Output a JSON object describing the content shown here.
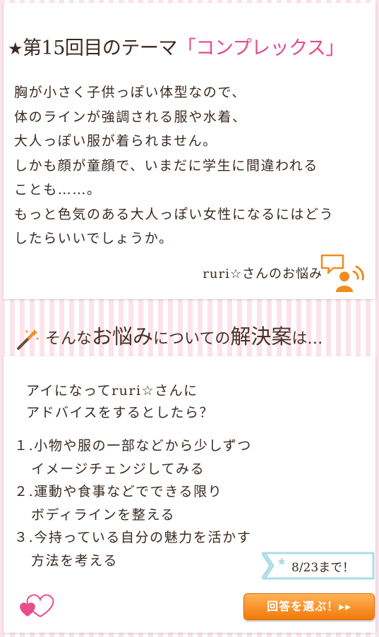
{
  "theme": {
    "star": "★",
    "title_prefix": "第15回目のテーマ",
    "title_highlight": "「コンプレックス」"
  },
  "problem_lines": [
    "胸が小さく子供っぽい体型なので、",
    "体のラインが強調される服や水着、",
    "大人っぽい服が着られません。",
    "しかも顔が童顔で、いまだに学生に間違われる",
    "ことも……。",
    "もっと色気のある大人っぽい女性になるにはどう",
    "したらいいでしょうか。"
  ],
  "signature": "ruri☆さんのお悩み",
  "banner": {
    "part1": "そんな",
    "part2": "お悩み",
    "part3": "についての",
    "part4": "解決案",
    "part5": "は…"
  },
  "advice": {
    "intro": [
      "アイになってruri☆さんに",
      "アドバイスをするとしたら？"
    ],
    "items": [
      {
        "line1": "１.小物や服の一部などから少しずつ",
        "line2": "イメージチェンジしてみる"
      },
      {
        "line1": "２.運動や食事などでできる限り",
        "line2": "ボディラインを整える"
      },
      {
        "line1": "３.今持っている自分の魅力を活かす",
        "line2": "方法を考える"
      }
    ]
  },
  "deadline": "8/23まで！",
  "answer_button": "回答を選ぶ！▸▸",
  "colors": {
    "accent_pink": "#e34a8c",
    "button_orange": "#f27a0a",
    "icon_orange": "#f08c1e",
    "ribbon_blue": "#a8dde8",
    "stripe_pink": "#fbe3ec"
  },
  "icons": {
    "speech": "speech-person-icon",
    "wand": "magic-wand-icon",
    "hearts": "hearts-icon"
  }
}
